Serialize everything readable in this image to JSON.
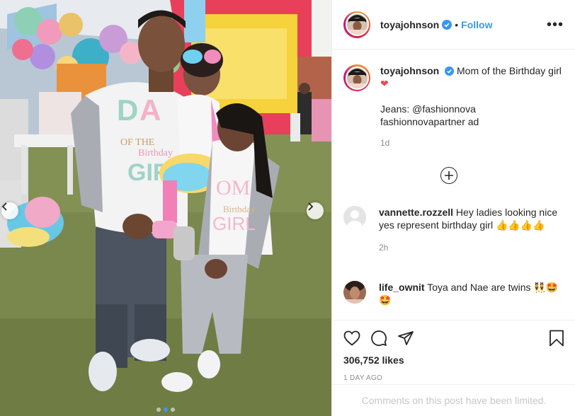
{
  "post": {
    "author": "toyajohnson",
    "follow_label": "Follow",
    "separator": "•",
    "caption_line1": "Mom of the Birthday girl",
    "caption_heart": "❤",
    "caption_line2": "Jeans: @fashionnova",
    "caption_line3": "fashionnovapartner ad",
    "caption_time": "1d",
    "likes": "306,752 likes",
    "time_ago": "1 DAY AGO",
    "comments_limited": "Comments on this post have been limited.",
    "carousel_count": 3,
    "carousel_active": 1
  },
  "comments": [
    {
      "user": "vannette.rozzell",
      "text": "Hey ladies looking nice yes represent birthday girl",
      "emoji": "👍👍👍👍",
      "time": "2h"
    },
    {
      "user": "life_ownit",
      "text": "Toya and Nae are twins",
      "emoji": "👯🤩🤩"
    }
  ],
  "icons": [
    "more-icon",
    "verified-icon",
    "add-icon",
    "heart-icon",
    "comment-icon",
    "share-icon",
    "bookmark-icon",
    "chevron-left-icon",
    "chevron-right-icon"
  ],
  "colors": {
    "link": "#3897f0",
    "muted": "#8e8e8e",
    "border": "#efefef",
    "heart": "#ed4956"
  }
}
